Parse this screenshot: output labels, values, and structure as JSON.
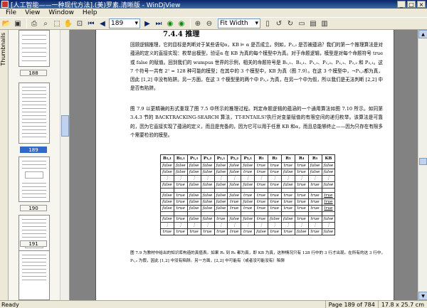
{
  "window": {
    "title": "[人工智能——一种现代方法].(美)罗素.清晰版 - WinDjView",
    "minimize": "_",
    "maximize": "□",
    "close": "×"
  },
  "menu": [
    "File",
    "View",
    "Window",
    "Help"
  ],
  "toolbar": {
    "page_value": "189",
    "zoom_value": "Fit Width"
  },
  "sidebar": {
    "tab_label": "Thumbnails",
    "pages": [
      {
        "label": "188",
        "selected": false
      },
      {
        "label": "189",
        "selected": true
      },
      {
        "label": "190",
        "selected": false
      },
      {
        "label": "191",
        "selected": false
      }
    ]
  },
  "document": {
    "section_title": "7.4.4   推理",
    "paragraphs": [
      "回顾逻辑推理，它的目标是判断对于某些语句α，KB ⊨ α 是否成立。例如，P₂,₂ 是否被蕴涵？我们的第一个推理算法是对蕴涵的定义的直接实现：枚举出模型，验证α 在 KB 为真的每个模型中为真。对于命题逻辑，模型是对每个命题符号 true 或 false 的赋值。回到我们的 wumpus 世界的示例，相关的命题符号是 B₁,₁、B₂,₁、P₁,₁、P₁,₂、P₂,₁、P₂,₂ 和 P₃,₁。这 7 个符号一共有 2⁷ = 128 种可能的模型；在其中的 3 个模型中，KB 为真（图 7.9）。在这 3 个模型中，¬P₁,₂都为真，因此 [1,2] 中没有陷阱。另一方面，在这 3 个模型里的两个中 P₂,₂ 为真，在另一个中为假，所以我们是无法判断 [2,2] 中是否有陷阱。",
      "图 7.9 以更精确的形式重现了图 7.5 中所示的推理过程。判定命题逻辑的蕴涵的一个通用算法如图 7.10 所示。如同第 3.4.3 节的 BACKTRACKING-SEARCH 算法，TT-ENTAILS?执行对变量赋值的有限空间的递归枚举。该算法是可靠的，因为它直接实现了蕴涵的定义，而且是完备的，因为它可以用于任意 KB 和α，而且总能够终止——因为只存在有限多个需要检验的模型。"
    ],
    "table": {
      "headers": [
        "B₁,₁",
        "B₂,₁",
        "P₁,₁",
        "P₁,₂",
        "P₂,₁",
        "P₂,₂",
        "P₃,₁",
        "R₁",
        "R₂",
        "R₃",
        "R₄",
        "R₅",
        "KB"
      ],
      "groups": [
        [
          [
            "false",
            "false",
            "false",
            "false",
            "false",
            "false",
            "false",
            "true",
            "true",
            "true",
            "true",
            "false",
            "false"
          ],
          [
            "false",
            "false",
            "false",
            "false",
            "false",
            "false",
            "true",
            "true",
            "true",
            "false",
            "true",
            "false",
            "false"
          ],
          [
            "⋮",
            "⋮",
            "⋮",
            "⋮",
            "⋮",
            "⋮",
            "⋮",
            "⋮",
            "⋮",
            "⋮",
            "⋮",
            "⋮",
            "⋮"
          ],
          [
            "false",
            "true",
            "false",
            "false",
            "false",
            "false",
            "false",
            "true",
            "true",
            "false",
            "true",
            "true",
            "false"
          ]
        ],
        [
          [
            "false",
            "true",
            "false",
            "false",
            "false",
            "false",
            "true",
            "true",
            "true",
            "true",
            "true",
            "true",
            "true"
          ],
          [
            "false",
            "true",
            "false",
            "false",
            "false",
            "true",
            "false",
            "true",
            "true",
            "true",
            "true",
            "true",
            "true"
          ],
          [
            "false",
            "true",
            "false",
            "false",
            "false",
            "true",
            "true",
            "true",
            "true",
            "true",
            "true",
            "true",
            "true"
          ]
        ],
        [
          [
            "false",
            "true",
            "false",
            "false",
            "true",
            "false",
            "false",
            "true",
            "false",
            "false",
            "true",
            "true",
            "false"
          ],
          [
            "⋮",
            "⋮",
            "⋮",
            "⋮",
            "⋮",
            "⋮",
            "⋮",
            "⋮",
            "⋮",
            "⋮",
            "⋮",
            "⋮",
            "⋮"
          ],
          [
            "true",
            "true",
            "true",
            "true",
            "true",
            "true",
            "true",
            "false",
            "true",
            "true",
            "false",
            "true",
            "false"
          ]
        ]
      ]
    },
    "caption": "图 7.9   为教材中给出的知识库构造的真值表。如果 R₁ 到 R₅ 都为真，即 KB 为真，这种情况只有 128 行中的 3 行才出现。在所有的这 3 行中，P₁,₂ 为假，因此 [1,2] 中没有陷阱。另一方面，[2,2] 中可能有（或者没可能没有）陷阱"
  },
  "status": {
    "ready": "Ready",
    "page_info": "Page 189 of 784",
    "page_size": "17.8 x 25.7 cm"
  }
}
